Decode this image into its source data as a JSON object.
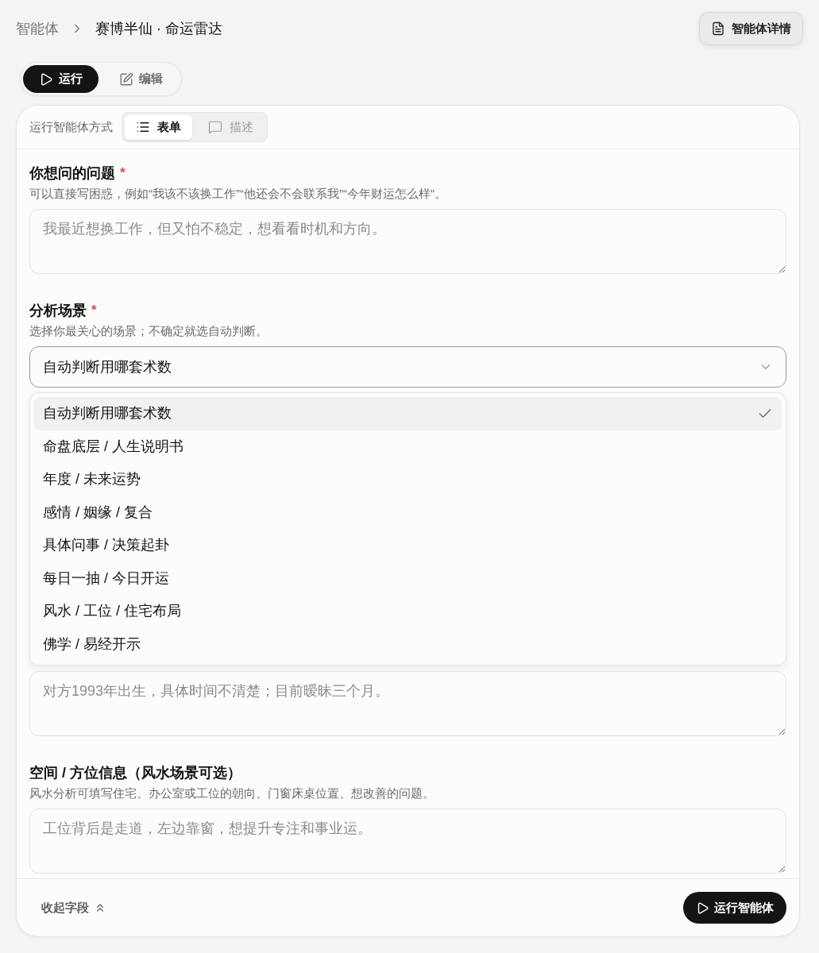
{
  "breadcrumb": {
    "items": [
      {
        "label": "智能体"
      },
      {
        "label": "赛博半仙 · 命运雷达"
      }
    ]
  },
  "details_button": {
    "label": "智能体详情"
  },
  "mode_tabs": [
    {
      "label": "运行",
      "selected": true
    },
    {
      "label": "编辑",
      "selected": false
    }
  ],
  "run_mode": {
    "label": "运行智能体方式",
    "options": [
      {
        "label": "表单",
        "selected": true
      },
      {
        "label": "描述",
        "selected": false
      }
    ]
  },
  "fields": [
    {
      "kind": "textarea",
      "label": "你想问的问题",
      "required_mark": "*",
      "hint": "可以直接写困惑，例如“我该不该换工作”“他还会不会联系我”“今年财运怎么样”。",
      "placeholder": "我最近想换工作，但又怕不稳定，想看看时机和方向。"
    },
    {
      "kind": "select",
      "label": "分析场景",
      "required_mark": "*",
      "hint": "选择你最关心的场景；不确定就选自动判断。",
      "value": "自动判断用哪套术数",
      "expanded": true,
      "options": [
        {
          "label": "自动判断用哪套术数",
          "selected": true
        },
        {
          "label": "命盘底层 / 人生说明书",
          "selected": false
        },
        {
          "label": "年度 / 未来运势",
          "selected": false
        },
        {
          "label": "感情 / 姻缘 / 复合",
          "selected": false
        },
        {
          "label": "具体问事 / 决策起卦",
          "selected": false
        },
        {
          "label": "每日一抽 / 今日开运",
          "selected": false
        },
        {
          "label": "风水 / 工位 / 住宅布局",
          "selected": false
        },
        {
          "label": "佛学 / 易经开示",
          "selected": false
        }
      ]
    },
    {
      "kind": "textarea",
      "placeholder": "对方1993年出生，具体时间不清楚；目前暧昧三个月。"
    },
    {
      "kind": "textarea",
      "label": "空间 / 方位信息（风水场景可选）",
      "hint": "风水分析可填写住宅、办公室或工位的朝向、门窗床桌位置、想改善的问题。",
      "placeholder": "工位背后是走道，左边靠窗，想提升专注和事业运。"
    }
  ],
  "footer": {
    "collapse_label": "收起字段",
    "run_button": "运行智能体"
  }
}
